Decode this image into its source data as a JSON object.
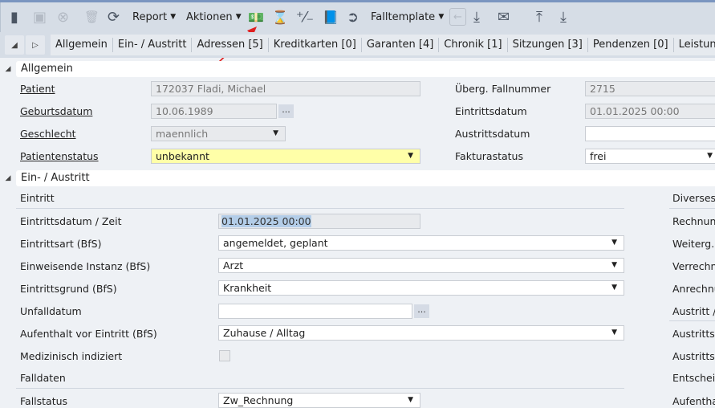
{
  "toolbar": {
    "report": "Report",
    "aktionen": "Aktionen",
    "falltemplate": "Falltemplate"
  },
  "tabs": [
    "Allgemein",
    "Ein- / Austritt",
    "Adressen [5]",
    "Kreditkarten [0]",
    "Garanten [4]",
    "Chronik [1]",
    "Sitzungen [3]",
    "Pendenzen [0]",
    "Leistungsübersicht"
  ],
  "allgemein": {
    "title": "Allgemein",
    "patient_label": "Patient",
    "patient": "172037 Fladi, Michael",
    "geburtsdatum_label": "Geburtsdatum",
    "geburtsdatum": "10.06.1989",
    "geschlecht_label": "Geschlecht",
    "geschlecht": "maennlich",
    "patientenstatus_label": "Patientenstatus",
    "patientenstatus": "unbekannt",
    "fallnummer_label": "Überg. Fallnummer",
    "fallnummer": "2715",
    "eintrittsdatum_label": "Eintrittsdatum",
    "eintrittsdatum": "01.01.2025 00:00",
    "austrittsdatum_label": "Austrittsdatum",
    "austrittsdatum": "",
    "fakturastatus_label": "Fakturastatus",
    "fakturastatus": "frei"
  },
  "einaus": {
    "title": "Ein- / Austritt",
    "eintritt": "Eintritt",
    "datum_label": "Eintrittsdatum / Zeit",
    "datum": "01.01.2025 00:00",
    "art_label": "Eintrittsart (BfS)",
    "art": "angemeldet, geplant",
    "instanz_label": "Einweisende Instanz (BfS)",
    "instanz": "Arzt",
    "grund_label": "Eintrittsgrund (BfS)",
    "grund": "Krankheit",
    "unfall_label": "Unfalldatum",
    "unfall": "",
    "aufenthalt_label": "Aufenthalt vor Eintritt (BfS)",
    "aufenthalt": "Zuhause / Alltag",
    "medizinisch_label": "Medizinisch indiziert",
    "falldaten": "Falldaten",
    "fallstatus_label": "Fallstatus",
    "fallstatus": "Zw_Rechnung",
    "right": [
      "Diverses",
      "Rechnun",
      "Weiterg.",
      "Verrechn",
      "Anrechnu",
      "Austritt /",
      "Austritts",
      "Austritts",
      "Entschei",
      "Aufentha"
    ]
  },
  "dots": "..."
}
